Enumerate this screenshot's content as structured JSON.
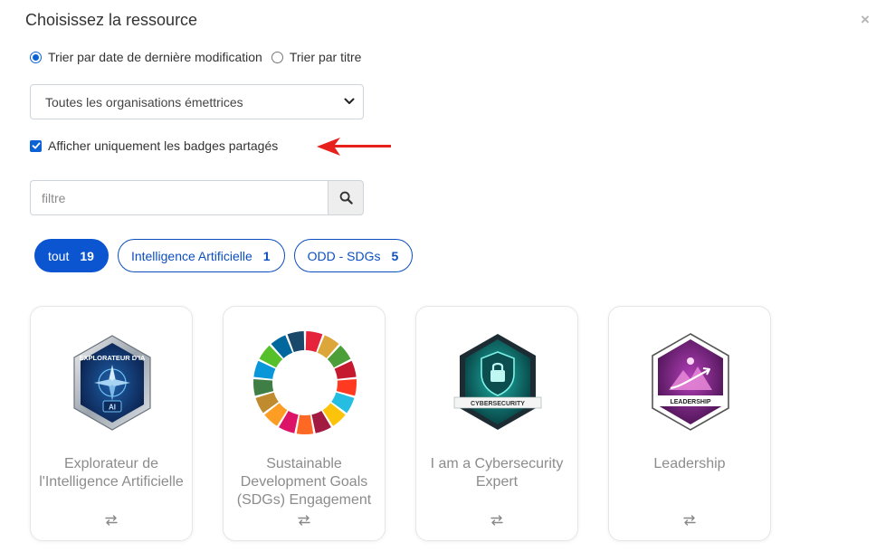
{
  "modal": {
    "title": "Choisissez la ressource",
    "close_label": "×"
  },
  "sort": {
    "options": [
      {
        "label": "Trier par date de dernière modification",
        "checked": true
      },
      {
        "label": "Trier par titre",
        "checked": false
      }
    ]
  },
  "org_select": {
    "value": "Toutes les organisations émettrices"
  },
  "shared_filter": {
    "label": "Afficher uniquement les badges partagés",
    "checked": true
  },
  "filter": {
    "placeholder": "filtre",
    "search_icon": "search-icon"
  },
  "chips": [
    {
      "label": "tout",
      "count": "19",
      "active": true
    },
    {
      "label": "Intelligence Artificielle",
      "count": "1",
      "active": false
    },
    {
      "label": "ODD - SDGs",
      "count": "5",
      "active": false
    }
  ],
  "cards": [
    {
      "title": "Explorateur de l'Intelligence Artificielle",
      "badge_text": "EXPLORATEUR D'IA",
      "badge_sub": "AI",
      "icon": "share-arrows-icon"
    },
    {
      "title": "Sustainable Development Goals (SDGs) Engagement",
      "icon": "share-arrows-icon"
    },
    {
      "title": "I am a Cybersecurity Expert",
      "badge_text": "CYBERSECURITY",
      "icon": "share-arrows-icon"
    },
    {
      "title": "Leadership",
      "badge_text": "LEADERSHIP",
      "icon": "share-arrows-icon"
    }
  ],
  "colors": {
    "accent": "#0b55d1",
    "annotation_arrow": "#e8201c",
    "sdg_wheel": [
      "#e5243b",
      "#dda63a",
      "#4c9f38",
      "#c5192d",
      "#ff3a21",
      "#26bde2",
      "#fcc30b",
      "#a21942",
      "#fd6925",
      "#dd1367",
      "#fd9d24",
      "#bf8b2e",
      "#3f7e44",
      "#0a97d9",
      "#56c02b",
      "#00689d",
      "#19486a"
    ]
  }
}
